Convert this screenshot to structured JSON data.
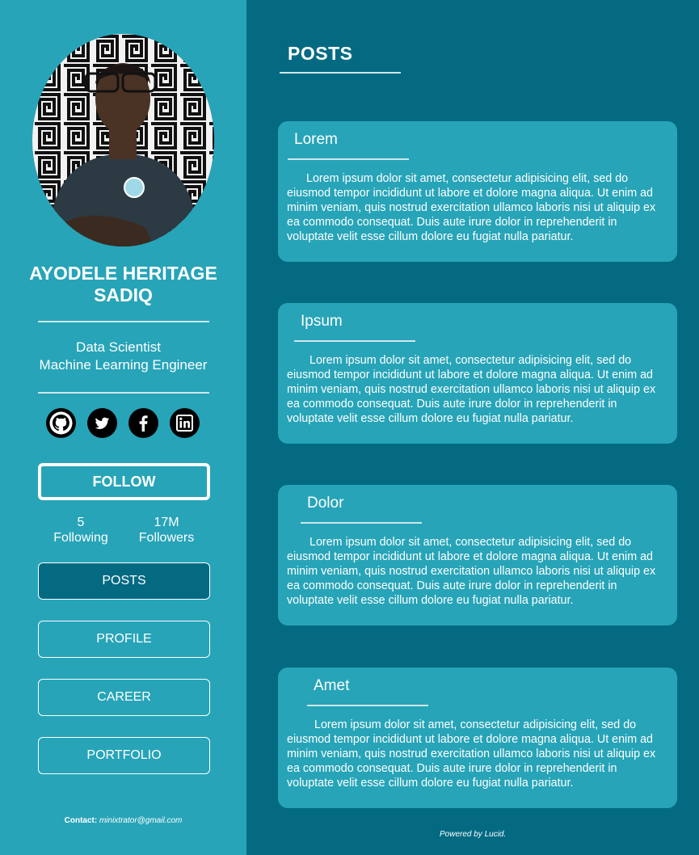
{
  "profile": {
    "name": "AYODELE HERITAGE SADIQ",
    "roles": [
      "Data Scientist",
      "Machine Learning Engineer"
    ],
    "follow_label": "FOLLOW",
    "following_count": "5",
    "following_label": "Following",
    "followers_count": "17M",
    "followers_label": "Followers"
  },
  "social": [
    "github-icon",
    "twitter-icon",
    "facebook-icon",
    "linkedin-icon"
  ],
  "nav": [
    {
      "label": "POSTS",
      "active": true
    },
    {
      "label": "PROFILE",
      "active": false
    },
    {
      "label": "CAREER",
      "active": false
    },
    {
      "label": "PORTFOLIO",
      "active": false
    }
  ],
  "contact": {
    "label": "Contact:",
    "email": "minixtrator@gmail.com"
  },
  "main": {
    "title": "POSTS",
    "posts": [
      {
        "title": "Lorem",
        "body": "Lorem ipsum dolor sit amet, consectetur adipisicing elit, sed do eiusmod tempor incididunt ut labore et dolore magna aliqua. Ut enim ad minim veniam, quis nostrud exercitation ullamco laboris nisi ut aliquip ex ea commodo consequat. Duis aute irure dolor in reprehenderit in voluptate velit esse cillum dolore eu fugiat nulla pariatur."
      },
      {
        "title": "Ipsum",
        "body": "Lorem ipsum dolor sit amet, consectetur adipisicing elit, sed do eiusmod tempor incididunt ut labore et dolore magna aliqua. Ut enim ad minim veniam, quis nostrud exercitation ullamco laboris nisi ut aliquip ex ea commodo consequat. Duis aute irure dolor in reprehenderit in voluptate velit esse cillum dolore eu fugiat nulla pariatur."
      },
      {
        "title": "Dolor",
        "body": "Lorem ipsum dolor sit amet, consectetur adipisicing elit, sed do eiusmod tempor incididunt ut labore et dolore magna aliqua. Ut enim ad minim veniam, quis nostrud exercitation ullamco laboris nisi ut aliquip ex ea commodo consequat. Duis aute irure dolor in reprehenderit in voluptate velit esse cillum dolore eu fugiat nulla pariatur."
      },
      {
        "title": "Amet",
        "body": "Lorem ipsum dolor sit amet, consectetur adipisicing elit, sed do eiusmod tempor incididunt ut labore et dolore magna aliqua. Ut enim ad minim veniam, quis nostrud exercitation ullamco laboris nisi ut aliquip ex ea commodo consequat. Duis aute irure dolor in reprehenderit in voluptate velit esse cillum dolore eu fugiat nulla pariatur."
      }
    ]
  },
  "footer": "Powered by Lucid.",
  "colors": {
    "sidebar": "#27a4b8",
    "main": "#036a82",
    "card": "#27a4b8",
    "active_nav": "#036a82"
  }
}
